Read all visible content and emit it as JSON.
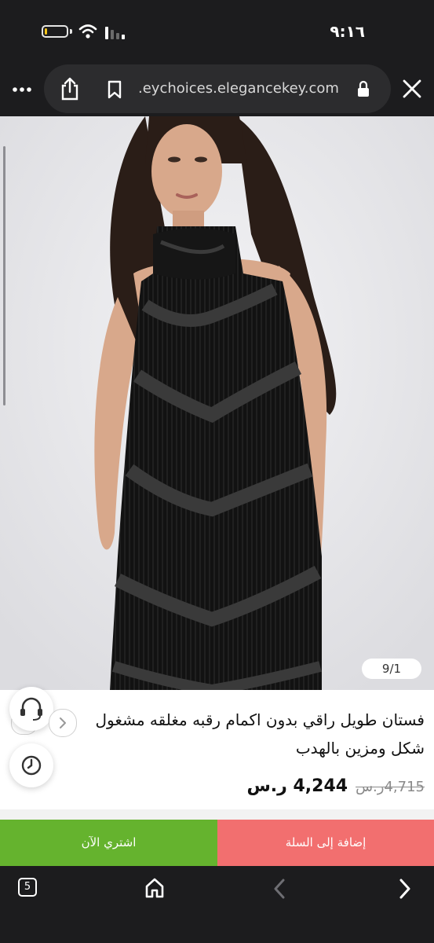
{
  "status": {
    "time": "٩:١٦",
    "battery_level": 0.12
  },
  "browser": {
    "url": ".eychoices.elegancekey.com"
  },
  "gallery": {
    "counter": "9/1"
  },
  "product": {
    "title": "فستان طويل راقي بدون اكمام رقبه مغلقه مشغول شكل ومزين بالهدب",
    "old_price": "4,715ر.س",
    "new_price": "4,244 ر.س"
  },
  "actions": {
    "buy_now": "اشتري الآن",
    "add_to_cart": "إضافة إلى السلة"
  },
  "nav": {
    "tab_count": "5"
  },
  "colors": {
    "buy_now": "#65b32e",
    "add_to_cart": "#f26f6f",
    "battery": "#f5c518"
  }
}
